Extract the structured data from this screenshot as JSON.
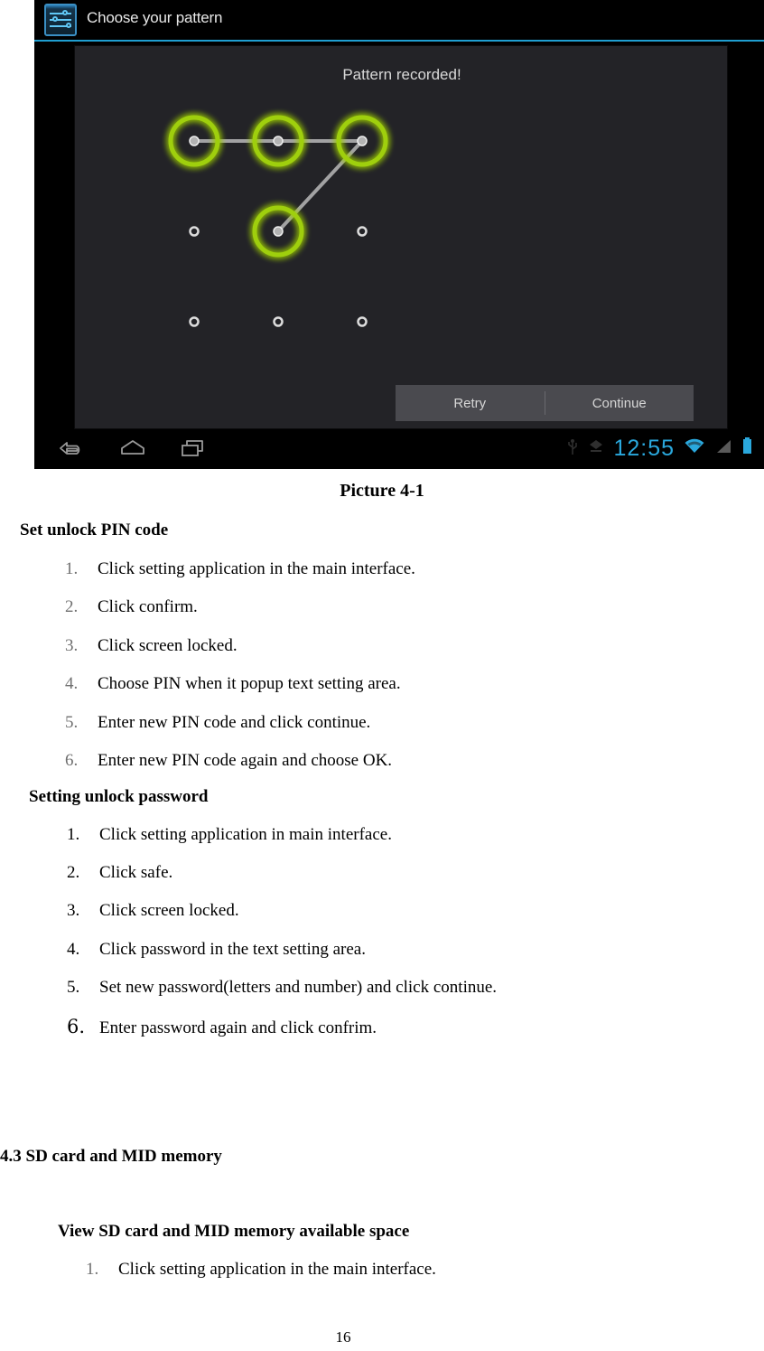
{
  "figure": {
    "actionbar": {
      "icon": "settings-sliders-icon",
      "title": "Choose your pattern"
    },
    "panel": {
      "status_text": "Pattern recorded!",
      "buttons": {
        "retry": "Retry",
        "continue": "Continue"
      },
      "pattern": {
        "rows": 3,
        "cols": 3,
        "active_dots": [
          0,
          1,
          2,
          4
        ],
        "path": [
          0,
          1,
          2,
          4
        ],
        "ring_color": "#9fcf10",
        "line_color": "#b8b8b8",
        "dot_color": "#b0b0b0",
        "inactive_dot_color": "#d8d8d8"
      }
    },
    "navbar": {
      "back": "back-icon",
      "home": "home-icon",
      "recents": "recents-icon"
    },
    "statusbar": {
      "usb": "usb-icon",
      "download": "download-icon",
      "clock": "12:55",
      "wifi": "wifi-icon",
      "signal": "signal-icon",
      "battery": "battery-icon",
      "clock_color": "#2aa8dd"
    }
  },
  "document": {
    "caption": "Picture 4-1",
    "section_pin": {
      "heading": "Set unlock PIN code",
      "steps": [
        {
          "num": "1.",
          "text": "Click setting application in the main interface."
        },
        {
          "num": "2.",
          "text": "Click confirm."
        },
        {
          "num": "3.",
          "text": "Click screen locked."
        },
        {
          "num": "4.",
          "text": "Choose PIN when it popup text setting area."
        },
        {
          "num": "5.",
          "text": "Enter new PIN code and click continue."
        },
        {
          "num": "6.",
          "text": "Enter new PIN code again and choose OK."
        }
      ]
    },
    "section_password": {
      "heading": "Setting unlock password",
      "steps": [
        {
          "num": "1.",
          "text": "Click setting application in main interface."
        },
        {
          "num": "2.",
          "text": "Click safe."
        },
        {
          "num": "3.",
          "text": "Click screen locked."
        },
        {
          "num": "4.",
          "text": "Click password in the text setting area."
        },
        {
          "num": "5.",
          "text": "Set new password(letters and number) and click continue."
        },
        {
          "num": "6.",
          "text": "Enter password again and click confrim."
        }
      ]
    },
    "section_sd": {
      "heading": "4.3 SD card and MID memory",
      "subheading": "View SD card and MID memory available space",
      "steps": [
        {
          "num": "1.",
          "text": "Click setting application in the main interface."
        }
      ]
    },
    "page_number": "16"
  }
}
